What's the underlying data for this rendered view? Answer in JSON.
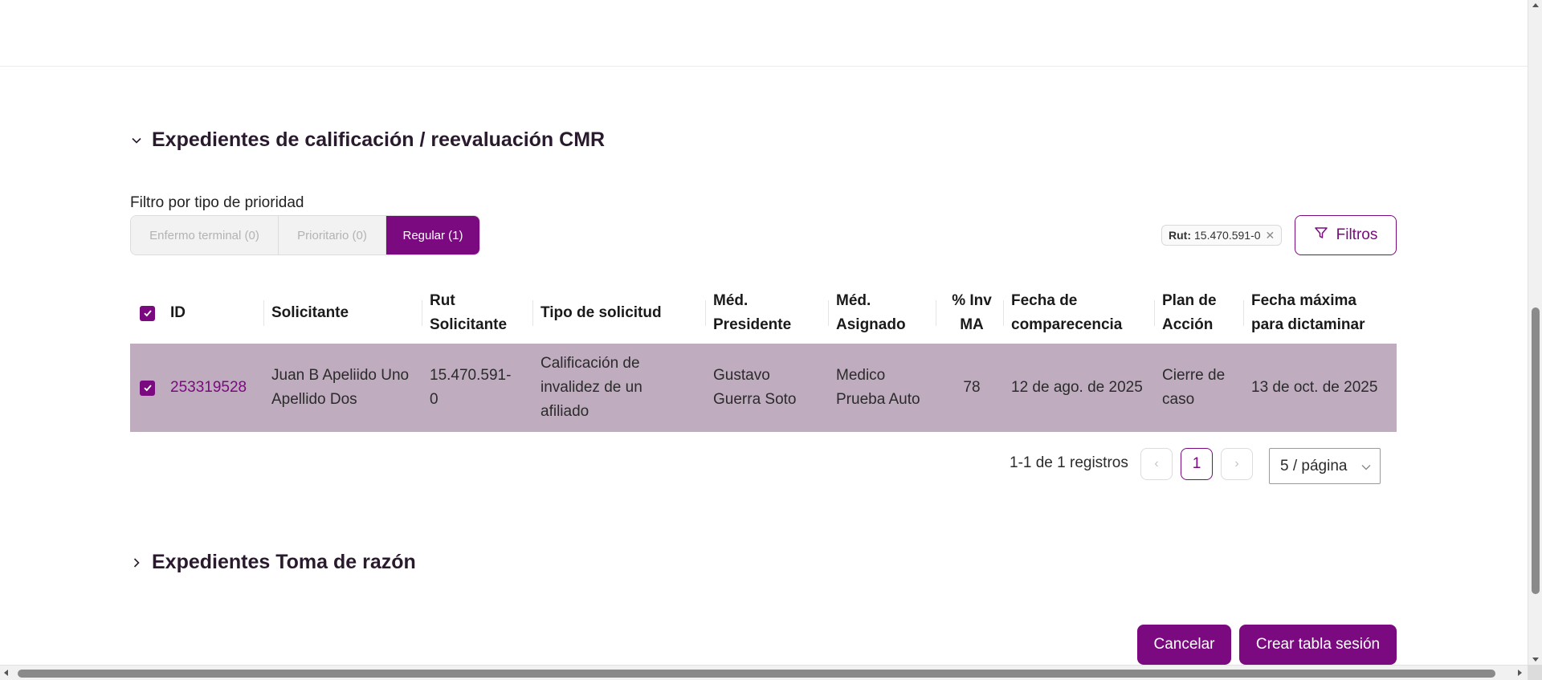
{
  "section1": {
    "title": "Expedientes de calificación / reevaluación CMR",
    "expanded": true
  },
  "section2": {
    "title": "Expedientes Toma de razón",
    "expanded": false
  },
  "priority_filter": {
    "label": "Filtro por tipo de prioridad",
    "options": [
      "Enfermo terminal (0)",
      "Prioritario (0)",
      "Regular (1)"
    ],
    "selected": "Regular (1)"
  },
  "active_filter_chip": {
    "key": "Rut:",
    "value": "15.470.591-0"
  },
  "filters_button": "Filtros",
  "table": {
    "headers": {
      "id": "ID",
      "solicitante": "Solicitante",
      "rut_1": "Rut",
      "rut_2": "Solicitante",
      "tipo": "Tipo de solicitud",
      "med_pres_1": "Méd.",
      "med_pres_2": "Presidente",
      "med_asig_1": "Méd.",
      "med_asig_2": "Asignado",
      "inv_1": "% Inv",
      "inv_2": "MA",
      "fecha_comp_1": "Fecha de",
      "fecha_comp_2": "comparecencia",
      "plan_1": "Plan de",
      "plan_2": "Acción",
      "fecha_max_1": "Fecha máxima",
      "fecha_max_2": "para dictaminar"
    },
    "rows": [
      {
        "id": "253319528",
        "solicitante_1": "Juan B Apeliido Uno",
        "solicitante_2": "Apellido Dos",
        "rut_1": "15.470.591-",
        "rut_2": "0",
        "tipo_1": "Calificación de",
        "tipo_2": "invalidez de un",
        "tipo_3": "afiliado",
        "med_pres_1": "Gustavo",
        "med_pres_2": "Guerra Soto",
        "med_asig_1": "Medico",
        "med_asig_2": "Prueba Auto",
        "inv": "78",
        "fecha_comp": "12 de ago. de 2025",
        "plan_1": "Cierre de",
        "plan_2": "caso",
        "fecha_max": "13 de oct. de 2025",
        "checked": true
      }
    ]
  },
  "pagination": {
    "info": "1-1 de 1 registros",
    "current_page": "1",
    "page_size": "5 / página"
  },
  "buttons": {
    "cancel": "Cancelar",
    "create": "Crear tabla sesión"
  },
  "colors": {
    "primary": "#7b0a80",
    "selected_row": "#bfacbf"
  }
}
